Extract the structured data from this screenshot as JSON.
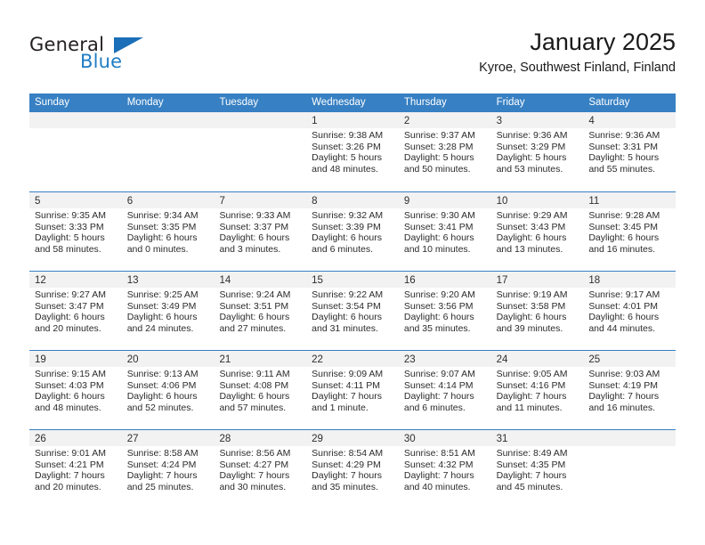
{
  "brand": {
    "name_primary": "General",
    "name_secondary": "Blue",
    "logo_icon": "triangle-logo-icon"
  },
  "header": {
    "title": "January 2025",
    "subtitle": "Kyroe, Southwest Finland, Finland"
  },
  "colors": {
    "header_blue": "#3780c3",
    "brand_blue": "#1f7dc4",
    "day_band_gray": "#f2f2f2",
    "text": "#2b2b2b"
  },
  "weekdays": [
    "Sunday",
    "Monday",
    "Tuesday",
    "Wednesday",
    "Thursday",
    "Friday",
    "Saturday"
  ],
  "weeks": [
    [
      {
        "day": "",
        "lines": []
      },
      {
        "day": "",
        "lines": []
      },
      {
        "day": "",
        "lines": []
      },
      {
        "day": "1",
        "lines": [
          "Sunrise: 9:38 AM",
          "Sunset: 3:26 PM",
          "Daylight: 5 hours",
          "and 48 minutes."
        ]
      },
      {
        "day": "2",
        "lines": [
          "Sunrise: 9:37 AM",
          "Sunset: 3:28 PM",
          "Daylight: 5 hours",
          "and 50 minutes."
        ]
      },
      {
        "day": "3",
        "lines": [
          "Sunrise: 9:36 AM",
          "Sunset: 3:29 PM",
          "Daylight: 5 hours",
          "and 53 minutes."
        ]
      },
      {
        "day": "4",
        "lines": [
          "Sunrise: 9:36 AM",
          "Sunset: 3:31 PM",
          "Daylight: 5 hours",
          "and 55 minutes."
        ]
      }
    ],
    [
      {
        "day": "5",
        "lines": [
          "Sunrise: 9:35 AM",
          "Sunset: 3:33 PM",
          "Daylight: 5 hours",
          "and 58 minutes."
        ]
      },
      {
        "day": "6",
        "lines": [
          "Sunrise: 9:34 AM",
          "Sunset: 3:35 PM",
          "Daylight: 6 hours",
          "and 0 minutes."
        ]
      },
      {
        "day": "7",
        "lines": [
          "Sunrise: 9:33 AM",
          "Sunset: 3:37 PM",
          "Daylight: 6 hours",
          "and 3 minutes."
        ]
      },
      {
        "day": "8",
        "lines": [
          "Sunrise: 9:32 AM",
          "Sunset: 3:39 PM",
          "Daylight: 6 hours",
          "and 6 minutes."
        ]
      },
      {
        "day": "9",
        "lines": [
          "Sunrise: 9:30 AM",
          "Sunset: 3:41 PM",
          "Daylight: 6 hours",
          "and 10 minutes."
        ]
      },
      {
        "day": "10",
        "lines": [
          "Sunrise: 9:29 AM",
          "Sunset: 3:43 PM",
          "Daylight: 6 hours",
          "and 13 minutes."
        ]
      },
      {
        "day": "11",
        "lines": [
          "Sunrise: 9:28 AM",
          "Sunset: 3:45 PM",
          "Daylight: 6 hours",
          "and 16 minutes."
        ]
      }
    ],
    [
      {
        "day": "12",
        "lines": [
          "Sunrise: 9:27 AM",
          "Sunset: 3:47 PM",
          "Daylight: 6 hours",
          "and 20 minutes."
        ]
      },
      {
        "day": "13",
        "lines": [
          "Sunrise: 9:25 AM",
          "Sunset: 3:49 PM",
          "Daylight: 6 hours",
          "and 24 minutes."
        ]
      },
      {
        "day": "14",
        "lines": [
          "Sunrise: 9:24 AM",
          "Sunset: 3:51 PM",
          "Daylight: 6 hours",
          "and 27 minutes."
        ]
      },
      {
        "day": "15",
        "lines": [
          "Sunrise: 9:22 AM",
          "Sunset: 3:54 PM",
          "Daylight: 6 hours",
          "and 31 minutes."
        ]
      },
      {
        "day": "16",
        "lines": [
          "Sunrise: 9:20 AM",
          "Sunset: 3:56 PM",
          "Daylight: 6 hours",
          "and 35 minutes."
        ]
      },
      {
        "day": "17",
        "lines": [
          "Sunrise: 9:19 AM",
          "Sunset: 3:58 PM",
          "Daylight: 6 hours",
          "and 39 minutes."
        ]
      },
      {
        "day": "18",
        "lines": [
          "Sunrise: 9:17 AM",
          "Sunset: 4:01 PM",
          "Daylight: 6 hours",
          "and 44 minutes."
        ]
      }
    ],
    [
      {
        "day": "19",
        "lines": [
          "Sunrise: 9:15 AM",
          "Sunset: 4:03 PM",
          "Daylight: 6 hours",
          "and 48 minutes."
        ]
      },
      {
        "day": "20",
        "lines": [
          "Sunrise: 9:13 AM",
          "Sunset: 4:06 PM",
          "Daylight: 6 hours",
          "and 52 minutes."
        ]
      },
      {
        "day": "21",
        "lines": [
          "Sunrise: 9:11 AM",
          "Sunset: 4:08 PM",
          "Daylight: 6 hours",
          "and 57 minutes."
        ]
      },
      {
        "day": "22",
        "lines": [
          "Sunrise: 9:09 AM",
          "Sunset: 4:11 PM",
          "Daylight: 7 hours",
          "and 1 minute."
        ]
      },
      {
        "day": "23",
        "lines": [
          "Sunrise: 9:07 AM",
          "Sunset: 4:14 PM",
          "Daylight: 7 hours",
          "and 6 minutes."
        ]
      },
      {
        "day": "24",
        "lines": [
          "Sunrise: 9:05 AM",
          "Sunset: 4:16 PM",
          "Daylight: 7 hours",
          "and 11 minutes."
        ]
      },
      {
        "day": "25",
        "lines": [
          "Sunrise: 9:03 AM",
          "Sunset: 4:19 PM",
          "Daylight: 7 hours",
          "and 16 minutes."
        ]
      }
    ],
    [
      {
        "day": "26",
        "lines": [
          "Sunrise: 9:01 AM",
          "Sunset: 4:21 PM",
          "Daylight: 7 hours",
          "and 20 minutes."
        ]
      },
      {
        "day": "27",
        "lines": [
          "Sunrise: 8:58 AM",
          "Sunset: 4:24 PM",
          "Daylight: 7 hours",
          "and 25 minutes."
        ]
      },
      {
        "day": "28",
        "lines": [
          "Sunrise: 8:56 AM",
          "Sunset: 4:27 PM",
          "Daylight: 7 hours",
          "and 30 minutes."
        ]
      },
      {
        "day": "29",
        "lines": [
          "Sunrise: 8:54 AM",
          "Sunset: 4:29 PM",
          "Daylight: 7 hours",
          "and 35 minutes."
        ]
      },
      {
        "day": "30",
        "lines": [
          "Sunrise: 8:51 AM",
          "Sunset: 4:32 PM",
          "Daylight: 7 hours",
          "and 40 minutes."
        ]
      },
      {
        "day": "31",
        "lines": [
          "Sunrise: 8:49 AM",
          "Sunset: 4:35 PM",
          "Daylight: 7 hours",
          "and 45 minutes."
        ]
      },
      {
        "day": "",
        "lines": []
      }
    ]
  ]
}
